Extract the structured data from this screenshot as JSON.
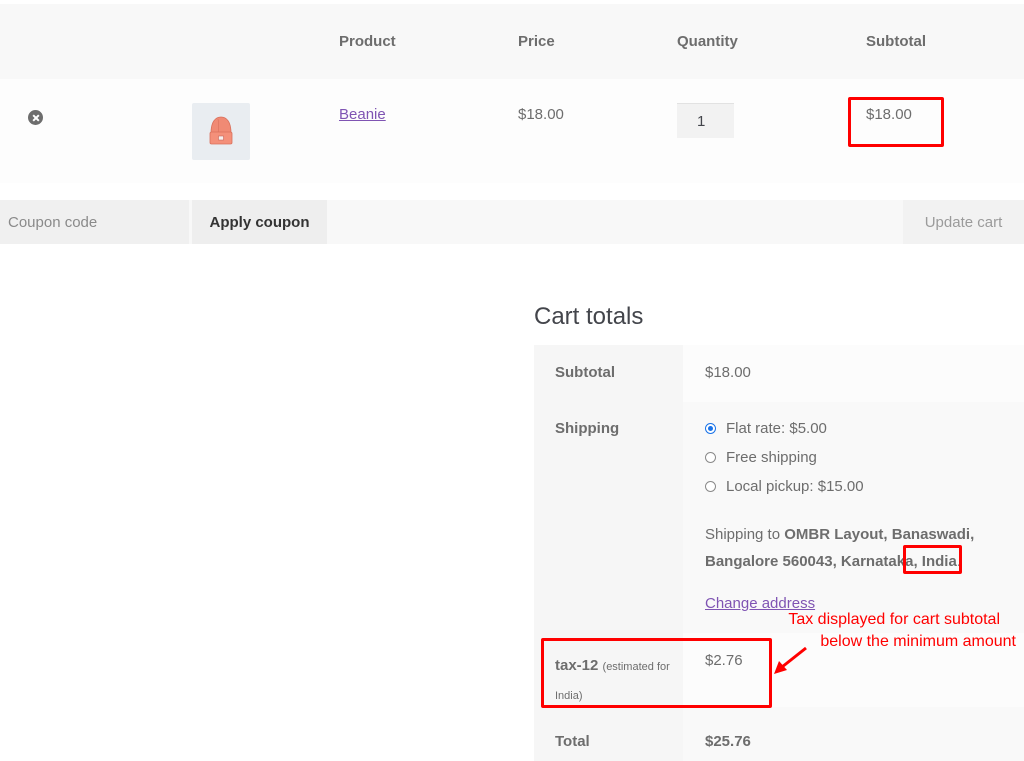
{
  "cart_table": {
    "headers": {
      "remove": "",
      "thumbnail": "",
      "product": "Product",
      "price": "Price",
      "quantity": "Quantity",
      "subtotal": "Subtotal"
    },
    "items": [
      {
        "remove_icon": "remove-circle-icon",
        "thumbnail": "beanie-image",
        "product": "Beanie",
        "price": "$18.00",
        "quantity": "1",
        "subtotal": "$18.00"
      }
    ]
  },
  "actions": {
    "coupon_placeholder": "Coupon code",
    "coupon_value": "",
    "apply_coupon_label": "Apply coupon",
    "update_cart_label": "Update cart"
  },
  "cart_totals": {
    "title": "Cart totals",
    "subtotal_label": "Subtotal",
    "subtotal_value": "$18.00",
    "shipping_label": "Shipping",
    "shipping_options": [
      {
        "label": "Flat rate: $5.00",
        "checked": true
      },
      {
        "label": "Free shipping",
        "checked": false
      },
      {
        "label": "Local pickup: $15.00",
        "checked": false
      }
    ],
    "shipping_destination_prefix": "Shipping to ",
    "shipping_destination_address": "OMBR Layout, Banaswadi, Bangalore 560043, Karnataka, ",
    "shipping_destination_country": "India",
    "shipping_destination_suffix": ".",
    "change_address_label": "Change address",
    "tax_name": "tax-12",
    "tax_note": "(estimated for India)",
    "tax_value": "$2.76",
    "total_label": "Total",
    "total_value": "$25.76"
  },
  "annotations": {
    "tax_note_line1": "Tax displayed for cart subtotal",
    "tax_note_line2": "below the minimum amount",
    "highlight_color": "#ff0000"
  },
  "colors": {
    "link": "#7f54b3",
    "radio_accent": "#1a73e8",
    "annotation": "#ff0000"
  }
}
